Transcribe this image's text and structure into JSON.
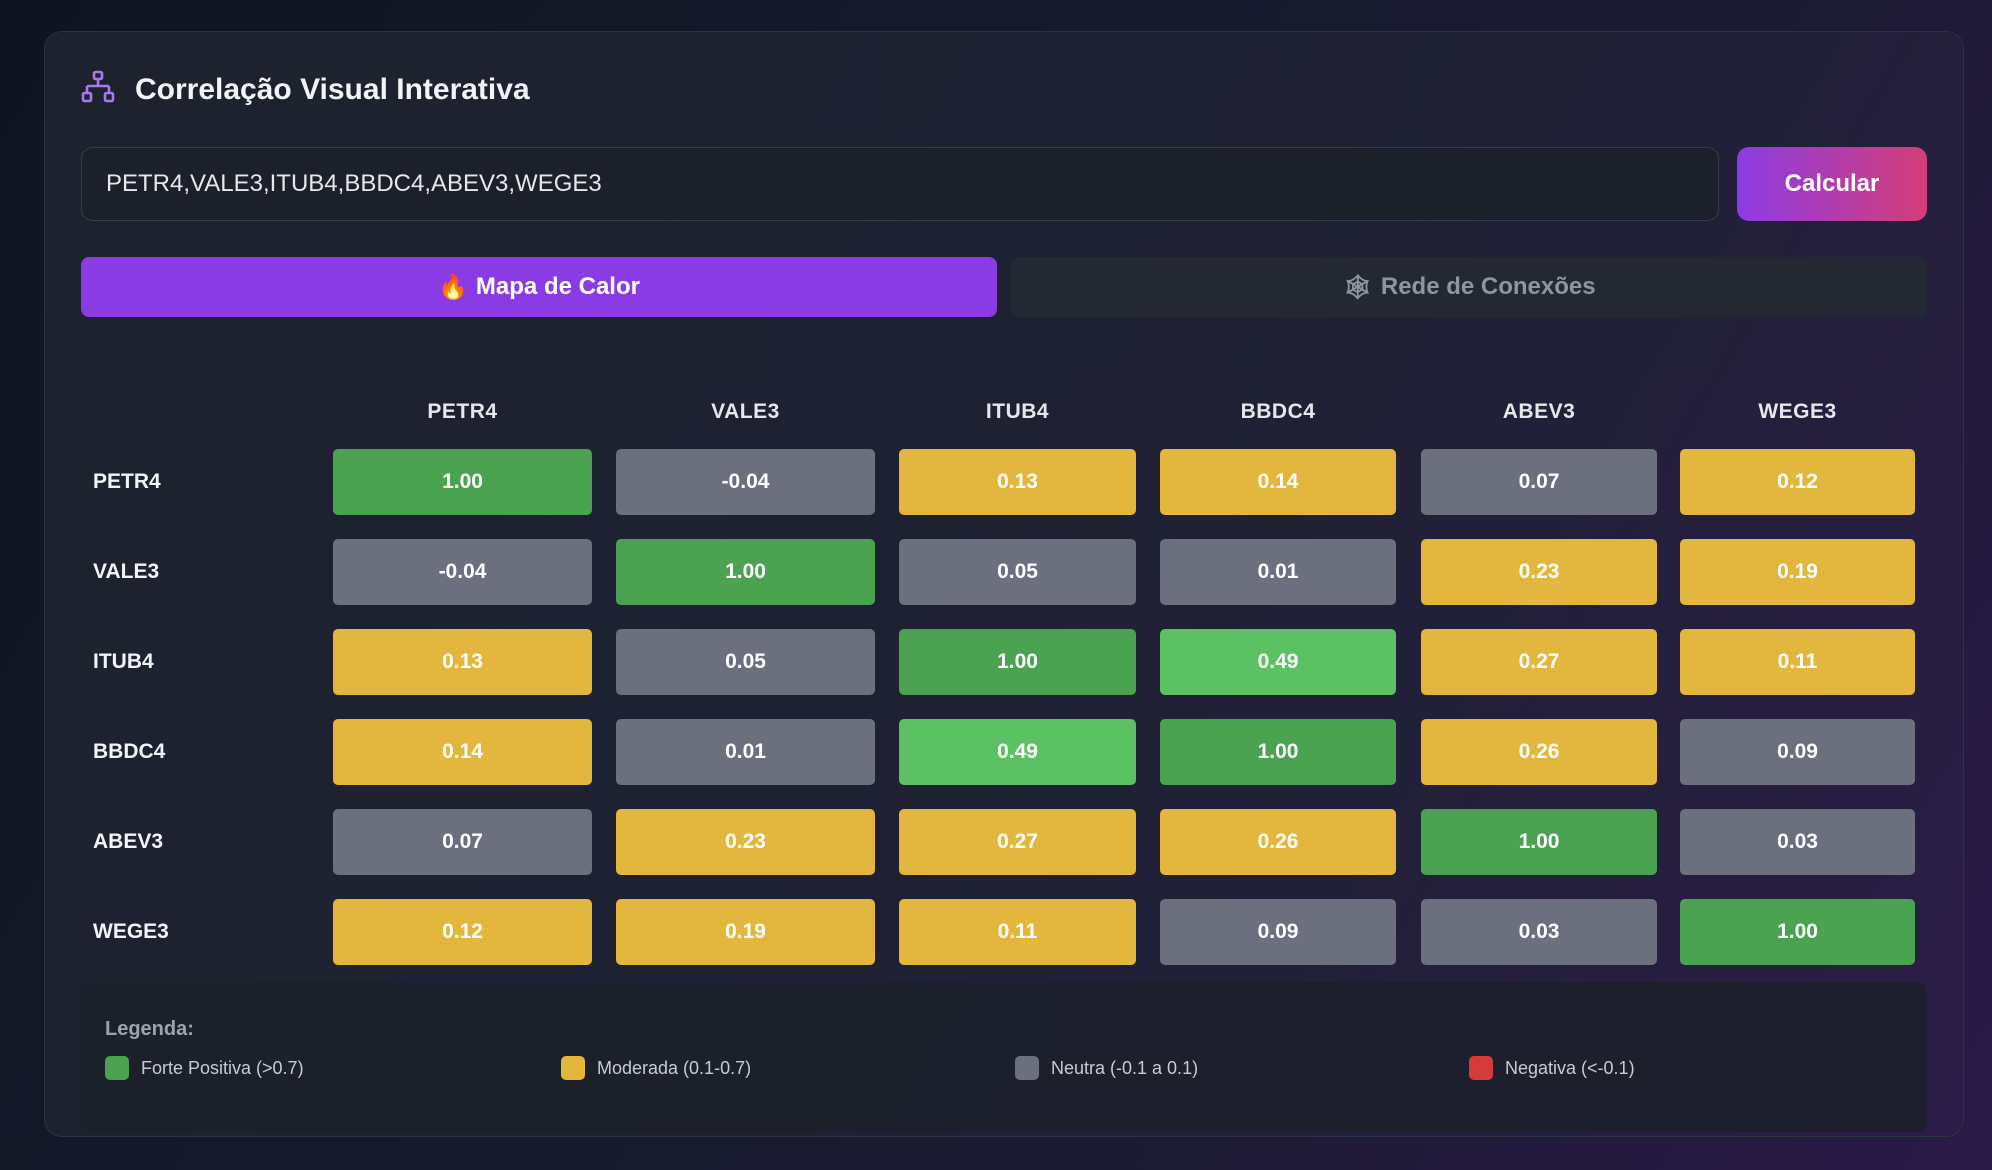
{
  "header": {
    "title": "Correlação Visual Interativa",
    "icon": "network-hierarchy-icon"
  },
  "input": {
    "tickers_value": "PETR4,VALE3,ITUB4,BBDC4,ABEV3,WEGE3"
  },
  "calculate_button": {
    "label": "Calcular"
  },
  "tabs": [
    {
      "label": "Mapa de Calor",
      "icon": "🔥",
      "active": true
    },
    {
      "label": "Rede de Conexões",
      "icon": "🕸",
      "active": false
    }
  ],
  "colors": {
    "strong_positive": "#4ba352",
    "strong_positive_light": "#5cc163",
    "moderate": "#e3b63e",
    "neutral": "#6b6f7e",
    "negative": "#d83a3a",
    "accent": "#8a3be3"
  },
  "chart_data": {
    "type": "heatmap",
    "tickers": [
      "PETR4",
      "VALE3",
      "ITUB4",
      "BBDC4",
      "ABEV3",
      "WEGE3"
    ],
    "matrix": [
      [
        "1.00",
        "-0.04",
        "0.13",
        "0.14",
        "0.07",
        "0.12"
      ],
      [
        "-0.04",
        "1.00",
        "0.05",
        "0.01",
        "0.23",
        "0.19"
      ],
      [
        "0.13",
        "0.05",
        "1.00",
        "0.49",
        "0.27",
        "0.11"
      ],
      [
        "0.14",
        "0.01",
        "0.49",
        "1.00",
        "0.26",
        "0.09"
      ],
      [
        "0.07",
        "0.23",
        "0.27",
        "0.26",
        "1.00",
        "0.03"
      ],
      [
        "0.12",
        "0.19",
        "0.11",
        "0.09",
        "0.03",
        "1.00"
      ]
    ]
  },
  "legend": {
    "title": "Legenda:",
    "items": [
      {
        "label": "Forte Positiva (>0.7)",
        "color": "#4ba352"
      },
      {
        "label": "Moderada (0.1-0.7)",
        "color": "#e3b63e"
      },
      {
        "label": "Neutra (-0.1 a 0.1)",
        "color": "#6b6f7e"
      },
      {
        "label": "Negativa (<-0.1)",
        "color": "#d83a3a"
      }
    ]
  }
}
